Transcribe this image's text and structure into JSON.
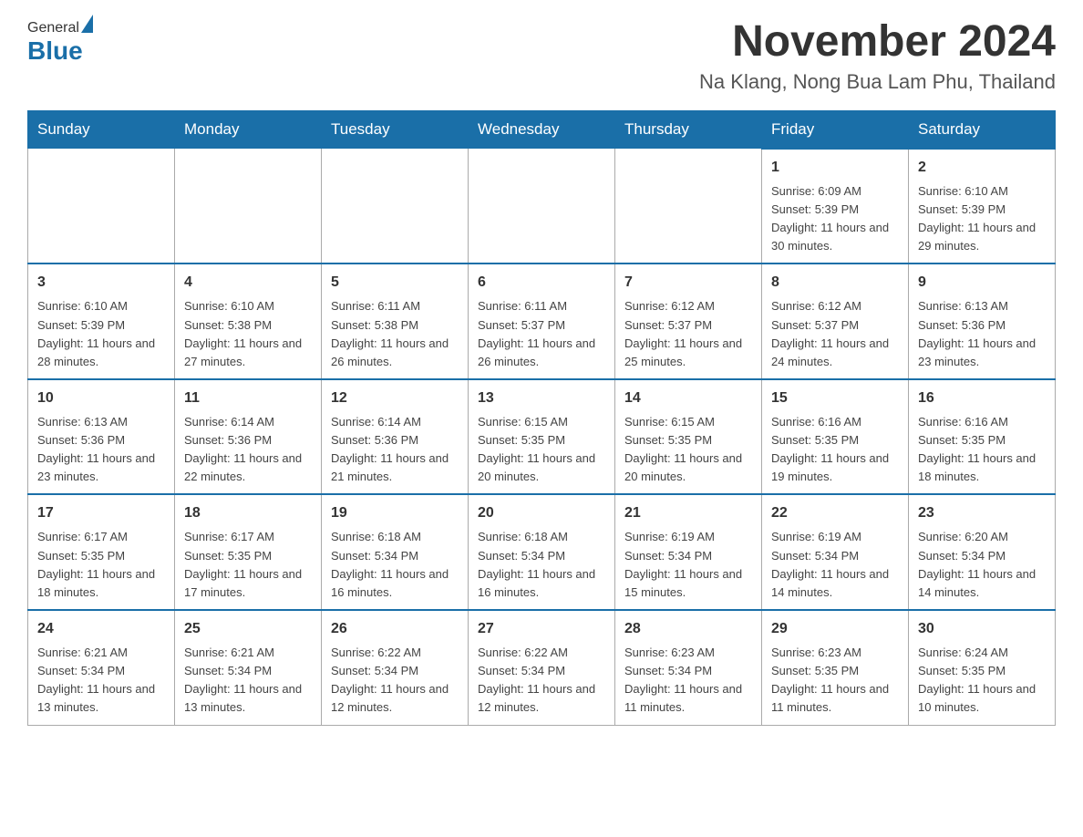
{
  "header": {
    "logo_general": "General",
    "logo_blue": "Blue",
    "title": "November 2024",
    "location": "Na Klang, Nong Bua Lam Phu, Thailand"
  },
  "days_of_week": [
    "Sunday",
    "Monday",
    "Tuesday",
    "Wednesday",
    "Thursday",
    "Friday",
    "Saturday"
  ],
  "weeks": [
    [
      {
        "day": "",
        "info": ""
      },
      {
        "day": "",
        "info": ""
      },
      {
        "day": "",
        "info": ""
      },
      {
        "day": "",
        "info": ""
      },
      {
        "day": "",
        "info": ""
      },
      {
        "day": "1",
        "info": "Sunrise: 6:09 AM\nSunset: 5:39 PM\nDaylight: 11 hours and 30 minutes."
      },
      {
        "day": "2",
        "info": "Sunrise: 6:10 AM\nSunset: 5:39 PM\nDaylight: 11 hours and 29 minutes."
      }
    ],
    [
      {
        "day": "3",
        "info": "Sunrise: 6:10 AM\nSunset: 5:39 PM\nDaylight: 11 hours and 28 minutes."
      },
      {
        "day": "4",
        "info": "Sunrise: 6:10 AM\nSunset: 5:38 PM\nDaylight: 11 hours and 27 minutes."
      },
      {
        "day": "5",
        "info": "Sunrise: 6:11 AM\nSunset: 5:38 PM\nDaylight: 11 hours and 26 minutes."
      },
      {
        "day": "6",
        "info": "Sunrise: 6:11 AM\nSunset: 5:37 PM\nDaylight: 11 hours and 26 minutes."
      },
      {
        "day": "7",
        "info": "Sunrise: 6:12 AM\nSunset: 5:37 PM\nDaylight: 11 hours and 25 minutes."
      },
      {
        "day": "8",
        "info": "Sunrise: 6:12 AM\nSunset: 5:37 PM\nDaylight: 11 hours and 24 minutes."
      },
      {
        "day": "9",
        "info": "Sunrise: 6:13 AM\nSunset: 5:36 PM\nDaylight: 11 hours and 23 minutes."
      }
    ],
    [
      {
        "day": "10",
        "info": "Sunrise: 6:13 AM\nSunset: 5:36 PM\nDaylight: 11 hours and 23 minutes."
      },
      {
        "day": "11",
        "info": "Sunrise: 6:14 AM\nSunset: 5:36 PM\nDaylight: 11 hours and 22 minutes."
      },
      {
        "day": "12",
        "info": "Sunrise: 6:14 AM\nSunset: 5:36 PM\nDaylight: 11 hours and 21 minutes."
      },
      {
        "day": "13",
        "info": "Sunrise: 6:15 AM\nSunset: 5:35 PM\nDaylight: 11 hours and 20 minutes."
      },
      {
        "day": "14",
        "info": "Sunrise: 6:15 AM\nSunset: 5:35 PM\nDaylight: 11 hours and 20 minutes."
      },
      {
        "day": "15",
        "info": "Sunrise: 6:16 AM\nSunset: 5:35 PM\nDaylight: 11 hours and 19 minutes."
      },
      {
        "day": "16",
        "info": "Sunrise: 6:16 AM\nSunset: 5:35 PM\nDaylight: 11 hours and 18 minutes."
      }
    ],
    [
      {
        "day": "17",
        "info": "Sunrise: 6:17 AM\nSunset: 5:35 PM\nDaylight: 11 hours and 18 minutes."
      },
      {
        "day": "18",
        "info": "Sunrise: 6:17 AM\nSunset: 5:35 PM\nDaylight: 11 hours and 17 minutes."
      },
      {
        "day": "19",
        "info": "Sunrise: 6:18 AM\nSunset: 5:34 PM\nDaylight: 11 hours and 16 minutes."
      },
      {
        "day": "20",
        "info": "Sunrise: 6:18 AM\nSunset: 5:34 PM\nDaylight: 11 hours and 16 minutes."
      },
      {
        "day": "21",
        "info": "Sunrise: 6:19 AM\nSunset: 5:34 PM\nDaylight: 11 hours and 15 minutes."
      },
      {
        "day": "22",
        "info": "Sunrise: 6:19 AM\nSunset: 5:34 PM\nDaylight: 11 hours and 14 minutes."
      },
      {
        "day": "23",
        "info": "Sunrise: 6:20 AM\nSunset: 5:34 PM\nDaylight: 11 hours and 14 minutes."
      }
    ],
    [
      {
        "day": "24",
        "info": "Sunrise: 6:21 AM\nSunset: 5:34 PM\nDaylight: 11 hours and 13 minutes."
      },
      {
        "day": "25",
        "info": "Sunrise: 6:21 AM\nSunset: 5:34 PM\nDaylight: 11 hours and 13 minutes."
      },
      {
        "day": "26",
        "info": "Sunrise: 6:22 AM\nSunset: 5:34 PM\nDaylight: 11 hours and 12 minutes."
      },
      {
        "day": "27",
        "info": "Sunrise: 6:22 AM\nSunset: 5:34 PM\nDaylight: 11 hours and 12 minutes."
      },
      {
        "day": "28",
        "info": "Sunrise: 6:23 AM\nSunset: 5:34 PM\nDaylight: 11 hours and 11 minutes."
      },
      {
        "day": "29",
        "info": "Sunrise: 6:23 AM\nSunset: 5:35 PM\nDaylight: 11 hours and 11 minutes."
      },
      {
        "day": "30",
        "info": "Sunrise: 6:24 AM\nSunset: 5:35 PM\nDaylight: 11 hours and 10 minutes."
      }
    ]
  ]
}
